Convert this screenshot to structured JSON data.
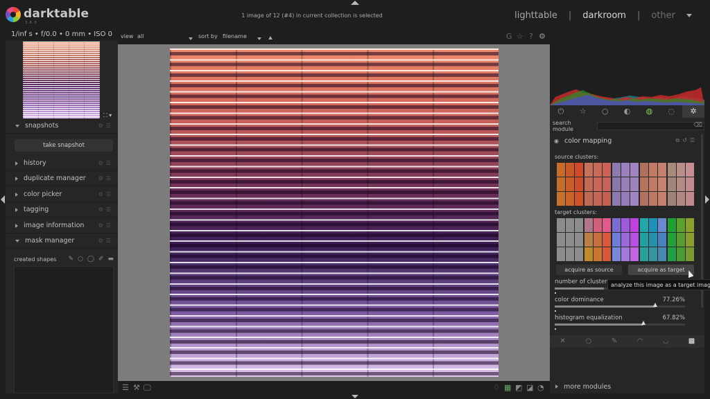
{
  "header": {
    "brand": "darktable",
    "version": "3.6.0",
    "collection_info": "1 image of 12 (#4) in current collection is selected",
    "views": {
      "lighttable": "lighttable",
      "darkroom": "darkroom",
      "other": "other",
      "separator": "|"
    }
  },
  "left": {
    "exif": "1/inf s • f/0.0 • 0 mm • ISO 0",
    "modules": [
      {
        "label": "snapshots"
      },
      {
        "label": "history"
      },
      {
        "label": "duplicate manager"
      },
      {
        "label": "color picker"
      },
      {
        "label": "tagging"
      },
      {
        "label": "image information"
      },
      {
        "label": "mask manager"
      }
    ],
    "take_snapshot": "take snapshot",
    "created_shapes": "created shapes"
  },
  "center": {
    "view_label": "view",
    "view_value": "all",
    "sort_label": "sort by",
    "sort_value": "filename"
  },
  "right": {
    "search_label": "search module",
    "module_title": "color mapping",
    "source_label": "source clusters:",
    "target_label": "target clusters:",
    "acquire_source": "acquire as source",
    "acquire_target": "acquire as target",
    "tooltip": "analyze this image as a target image",
    "sliders": [
      {
        "label": "number of clusters",
        "value": "",
        "fraction": 0.38
      },
      {
        "label": "color dominance",
        "value": "77.26%",
        "fraction": 0.7726
      },
      {
        "label": "histogram equalization",
        "value": "67.82%",
        "fraction": 0.6782
      }
    ],
    "more_modules": "more modules",
    "source_clusters": [
      [
        "#c76a2a",
        "#c85a2a",
        "#d04a2a",
        "#c46c2c",
        "#c95e2a",
        "#cf4d29",
        "#c5702d",
        "#c9622b",
        "#ce5328"
      ],
      [
        "#c6715c",
        "#c96a58",
        "#cb6457",
        "#c46b58",
        "#c9675a",
        "#c4635a",
        "#c06a55",
        "#c56756",
        "#c26052"
      ],
      [
        "#8f7ab0",
        "#9a80bc",
        "#a283c2",
        "#8a78ad",
        "#977fb8",
        "#9f82c0",
        "#8c79ae",
        "#967cb6",
        "#a185c3"
      ],
      [
        "#b07060",
        "#c07a66",
        "#c68070",
        "#b3735d",
        "#c07a68",
        "#c78270",
        "#b17262",
        "#be7966",
        "#c8806e"
      ],
      [
        "#a88a7a",
        "#b78f88",
        "#c88d92",
        "#a3867a",
        "#b38c86",
        "#c38a8e",
        "#9f8378",
        "#af8984",
        "#c1888d"
      ]
    ],
    "target_clusters": [
      [
        "#8c8c8c",
        "#8c8c8c",
        "#8c8c8c",
        "#8c8c8c",
        "#8c8c8c",
        "#8c8c8c",
        "#8c8c8c",
        "#8c8c8c",
        "#8c8c8c"
      ],
      [
        "#b0788a",
        "#d0607a",
        "#e05a8c",
        "#b98048",
        "#c5703e",
        "#d75a3c",
        "#c08a2c",
        "#c97730",
        "#d3593a"
      ],
      [
        "#7a6cd0",
        "#9c5cd8",
        "#c040e0",
        "#6f7cd8",
        "#9a6ad8",
        "#b74fe0",
        "#7888d8",
        "#a07ad8",
        "#c066e0"
      ],
      [
        "#20a8a8",
        "#2090b8",
        "#6a8ad0",
        "#20a0a0",
        "#2890a8",
        "#4a80c0",
        "#2aa09a",
        "#3894a0",
        "#4a88b0"
      ],
      [
        "#20a030",
        "#5ca030",
        "#8aa02c",
        "#24a23a",
        "#5a9c34",
        "#8a9c2c",
        "#22a048",
        "#4c9a36",
        "#7a9a2e"
      ]
    ]
  }
}
